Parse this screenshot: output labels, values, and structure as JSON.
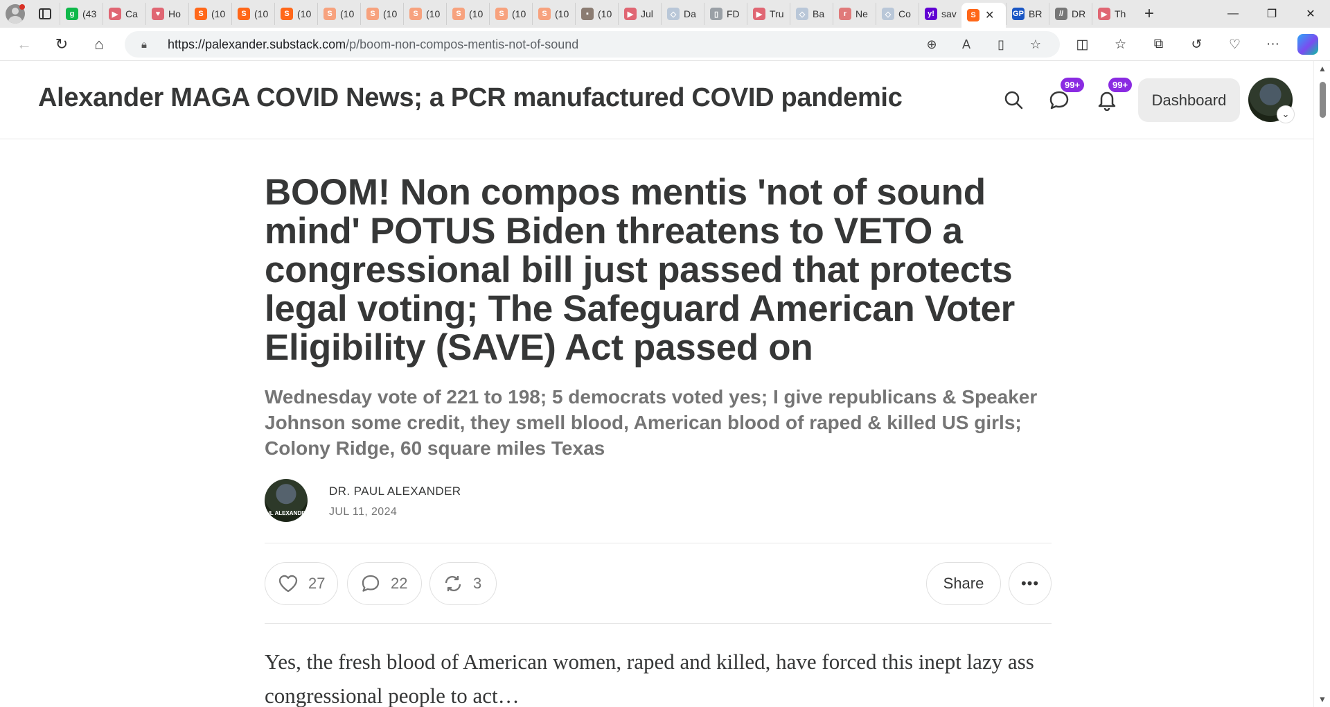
{
  "browser": {
    "tabs": [
      {
        "label": "(43",
        "fav": "g",
        "color": "#0fb84a"
      },
      {
        "label": "Ca",
        "fav": "▶",
        "color": "#e06673"
      },
      {
        "label": "Ho",
        "fav": "♥",
        "color": "#e06673"
      },
      {
        "label": "(10",
        "fav": "S",
        "color": "#ff6719"
      },
      {
        "label": "(10",
        "fav": "S",
        "color": "#ff6719"
      },
      {
        "label": "(10",
        "fav": "S",
        "color": "#ff6719"
      },
      {
        "label": "(10",
        "fav": "S",
        "color": "#f7a27e"
      },
      {
        "label": "(10",
        "fav": "S",
        "color": "#f7a27e"
      },
      {
        "label": "(10",
        "fav": "S",
        "color": "#f7a27e"
      },
      {
        "label": "(10",
        "fav": "S",
        "color": "#f7a27e"
      },
      {
        "label": "(10",
        "fav": "S",
        "color": "#f7a27e"
      },
      {
        "label": "(10",
        "fav": "S",
        "color": "#f7a27e"
      },
      {
        "label": "(10",
        "fav": "▪",
        "color": "#8b7c72"
      },
      {
        "label": "Jul",
        "fav": "▶",
        "color": "#e06673"
      },
      {
        "label": "Da",
        "fav": "◇",
        "color": "#b9c7d8"
      },
      {
        "label": "FD",
        "fav": "▯",
        "color": "#9aa0a6"
      },
      {
        "label": "Tru",
        "fav": "▶",
        "color": "#e06673"
      },
      {
        "label": "Ba",
        "fav": "◇",
        "color": "#b9c7d8"
      },
      {
        "label": "Ne",
        "fav": "r",
        "color": "#e07a7a"
      },
      {
        "label": "Co",
        "fav": "◇",
        "color": "#b9c7d8"
      },
      {
        "label": "sav",
        "fav": "y!",
        "color": "#6001d2"
      }
    ],
    "active_tab": {
      "fav": "S",
      "color": "#ff6719"
    },
    "tabs_after": [
      {
        "label": "BR",
        "fav": "GP",
        "color": "#1a56c4"
      },
      {
        "label": "DR",
        "fav": "//",
        "color": "#777777"
      },
      {
        "label": "Th",
        "fav": "▶",
        "color": "#e06673"
      }
    ],
    "url_host": "https://palexander.substack.com",
    "url_path": "/p/boom-non-compos-mentis-not-of-sound"
  },
  "site": {
    "title": "Alexander MAGA COVID News; a PCR manufactured COVID pandemic",
    "chat_badge": "99+",
    "notif_badge": "99+",
    "dashboard_label": "Dashboard"
  },
  "post": {
    "title": "BOOM! Non compos mentis 'not of sound mind' POTUS Biden threatens to VETO a congressional bill just passed that protects legal voting; The Safeguard American Voter Eligibility (SAVE) Act passed on",
    "subtitle": "Wednesday vote of 221 to 198; 5 democrats voted yes; I give republicans & Speaker Johnson some credit, they smell blood, American blood of raped & killed US girls; Colony Ridge, 60 square miles Texas",
    "author": "DR. PAUL ALEXANDER",
    "author_avatar_caption": "UL ALEXANDER",
    "date": "JUL 11, 2024",
    "likes": "27",
    "comments": "22",
    "restacks": "3",
    "share_label": "Share",
    "more_label": "•••",
    "body": "Yes, the fresh blood of American women, raped and killed, have forced this inept lazy ass congressional people to act…"
  }
}
